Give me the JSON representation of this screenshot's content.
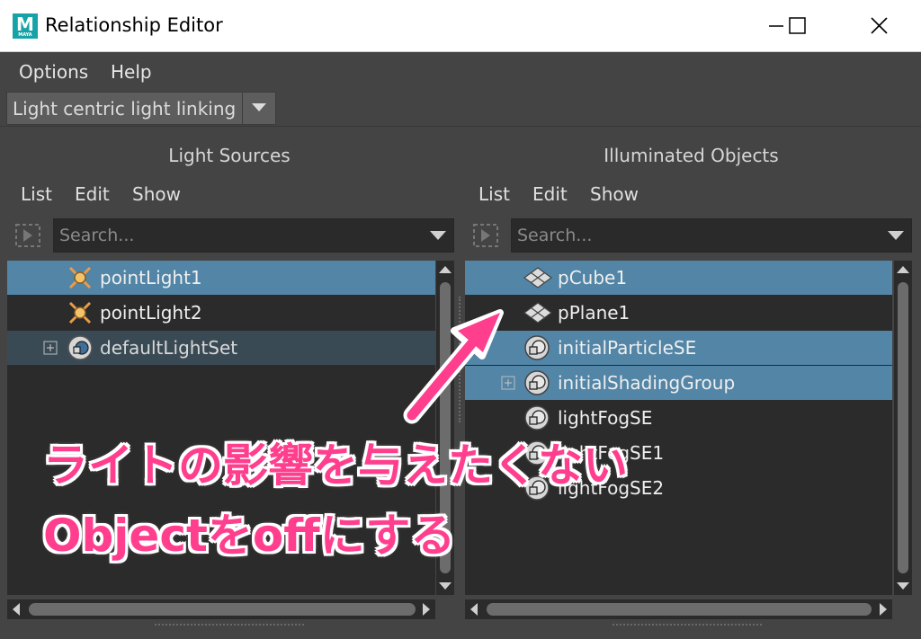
{
  "window": {
    "title": "Relationship Editor",
    "logo_letter": "M",
    "logo_sub": "MAYA"
  },
  "menubar": {
    "items": [
      "Options",
      "Help"
    ]
  },
  "mode_dropdown": {
    "value": "Light centric light linking"
  },
  "left_panel": {
    "title": "Light Sources",
    "menu": [
      "List",
      "Edit",
      "Show"
    ],
    "search_placeholder": "Search...",
    "rows": [
      {
        "label": "pointLight1",
        "icon": "point-light-icon",
        "state": "selected"
      },
      {
        "label": "pointLight2",
        "icon": "point-light-icon",
        "state": "normal"
      },
      {
        "label": "defaultLightSet",
        "icon": "set-icon",
        "state": "dim",
        "expandable": true
      }
    ]
  },
  "right_panel": {
    "title": "Illuminated Objects",
    "menu": [
      "List",
      "Edit",
      "Show"
    ],
    "search_placeholder": "Search...",
    "rows": [
      {
        "label": "pCube1",
        "icon": "mesh-icon",
        "state": "selected"
      },
      {
        "label": "pPlane1",
        "icon": "mesh-icon",
        "state": "normal"
      },
      {
        "label": "initialParticleSE",
        "icon": "shading-group-icon",
        "state": "selected"
      },
      {
        "label": "initialShadingGroup",
        "icon": "shading-group-icon",
        "state": "selected",
        "expandable": true
      },
      {
        "label": "lightFogSE",
        "icon": "shading-group-icon",
        "state": "normal"
      },
      {
        "label": "lightFogSE1",
        "icon": "shading-group-icon",
        "state": "normal"
      },
      {
        "label": "lightFogSE2",
        "icon": "shading-group-icon",
        "state": "normal"
      }
    ]
  },
  "annotation": {
    "line1": "ライトの影響を与えたくない",
    "line2": "Objectをoffにする",
    "color": "#ff3f8e"
  },
  "colors": {
    "selected_row": "#5285a6",
    "panel_bg": "#444444",
    "list_bg": "#2b2b2b"
  }
}
